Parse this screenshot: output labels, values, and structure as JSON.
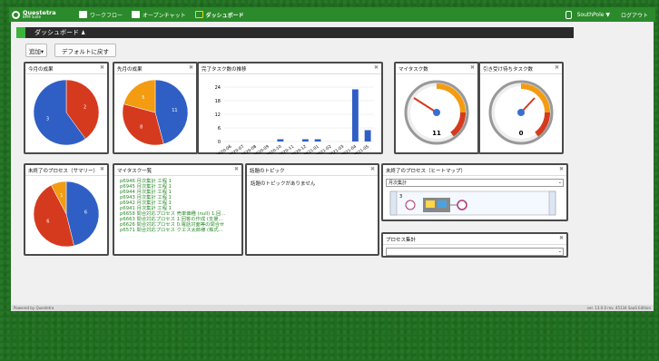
{
  "header": {
    "logo_title": "Questetra",
    "logo_subtitle": "BPM Suite",
    "nav": [
      {
        "label": "ワークフロー"
      },
      {
        "label": "オープンチャット"
      },
      {
        "label": "ダッシュボード"
      }
    ],
    "user": "SouthPole ▼",
    "logout": "ログアウト"
  },
  "page": {
    "title": "ダッシュボード",
    "add_button": "追加▾",
    "reset_button": "デフォルトに戻す"
  },
  "widgets": {
    "month": {
      "title": "今月の成果"
    },
    "prev": {
      "title": "先月の成果"
    },
    "trend": {
      "title": "完了タスク数の推移"
    },
    "mytask_count": {
      "title": "マイタスク数",
      "value": "11"
    },
    "claim_count": {
      "title": "引き受け待ちタスク数",
      "value": "0"
    },
    "open_summary": {
      "title": "未終了のプロセス（サマリー）"
    },
    "mytask_list": {
      "title": "マイタスク一覧",
      "items": [
        "p6946 月次集計 工程 1",
        "p6945 月次集計 工程 1",
        "p6944 月次集計 工程 1",
        "p6943 月次集計 工程 1",
        "p6942 月次集計 工程 1",
        "p6941 月次集計 工程 1",
        "p6658 問合対応プロセス 売単価種 (null) 1.回...",
        "p6663 問合対応プロセス 1.回答の作成 (支援...",
        "p6626 問合対応プロセス 0.電話対面等の問合せ",
        "p6571 問合対応プロセス クエス太郎様 (株式..."
      ]
    },
    "topics": {
      "title": "話題のトピック",
      "empty": "話題のトピックがありません"
    },
    "heatmap": {
      "title": "未終了のプロセス（ヒートマップ）",
      "select": "月次集計"
    },
    "process_agg": {
      "title": "プロセス集計",
      "select": ""
    }
  },
  "footer": {
    "left": "Powered by Questetra",
    "right": "ver. 13.0.0 rev. 45134 SaaS Edition"
  },
  "chart_data": [
    {
      "type": "pie",
      "title": "今月の成果",
      "slices": [
        {
          "label": "2",
          "value": 2,
          "color": "#d63a1e"
        },
        {
          "label": "3",
          "value": 3,
          "color": "#2f5fc4"
        }
      ]
    },
    {
      "type": "pie",
      "title": "先月の成果",
      "slices": [
        {
          "label": "11",
          "value": 11,
          "color": "#2f5fc4"
        },
        {
          "label": "8",
          "value": 8,
          "color": "#d63a1e"
        },
        {
          "label": "5",
          "value": 5,
          "color": "#f39c12"
        }
      ]
    },
    {
      "type": "bar",
      "title": "完了タスク数の推移",
      "categories": [
        "2020-06",
        "2020-07",
        "2020-08",
        "2020-09",
        "2020-10",
        "2020-11",
        "2020-12",
        "2021-01",
        "2021-02",
        "2021-03",
        "2021-04",
        "2021-05"
      ],
      "values": [
        0,
        0,
        0,
        0,
        1,
        0,
        1,
        1,
        0,
        0,
        23,
        5
      ],
      "ylim": [
        0,
        24
      ],
      "yticks": [
        "24",
        "18",
        "12",
        "6",
        "0"
      ]
    },
    {
      "type": "pie",
      "title": "未終了のプロセス（サマリー）",
      "slices": [
        {
          "label": "6",
          "value": 6,
          "color": "#2f5fc4"
        },
        {
          "label": "6",
          "value": 6,
          "color": "#d63a1e"
        },
        {
          "label": "1",
          "value": 1,
          "color": "#f39c12"
        }
      ]
    }
  ]
}
